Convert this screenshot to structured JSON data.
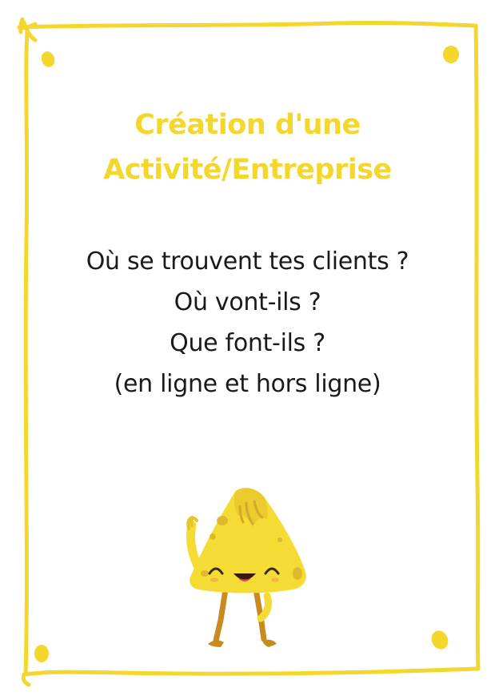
{
  "card": {
    "title_lines": [
      "Création d'une",
      "Activité/Entreprise"
    ],
    "question_lines": [
      "Où se trouvent tes clients ?",
      "Où vont-ils ?",
      "Que font-ils ?",
      "(en ligne et hors ligne)"
    ]
  },
  "colors": {
    "accent": "#f4d72d",
    "mascot_body": "#f4dc34",
    "mascot_spots": "#dcb42a",
    "mascot_legs": "#c98b1e",
    "text": "#1a1a1a"
  },
  "icons": {
    "mascot": "cheese-wedge-character-icon"
  }
}
